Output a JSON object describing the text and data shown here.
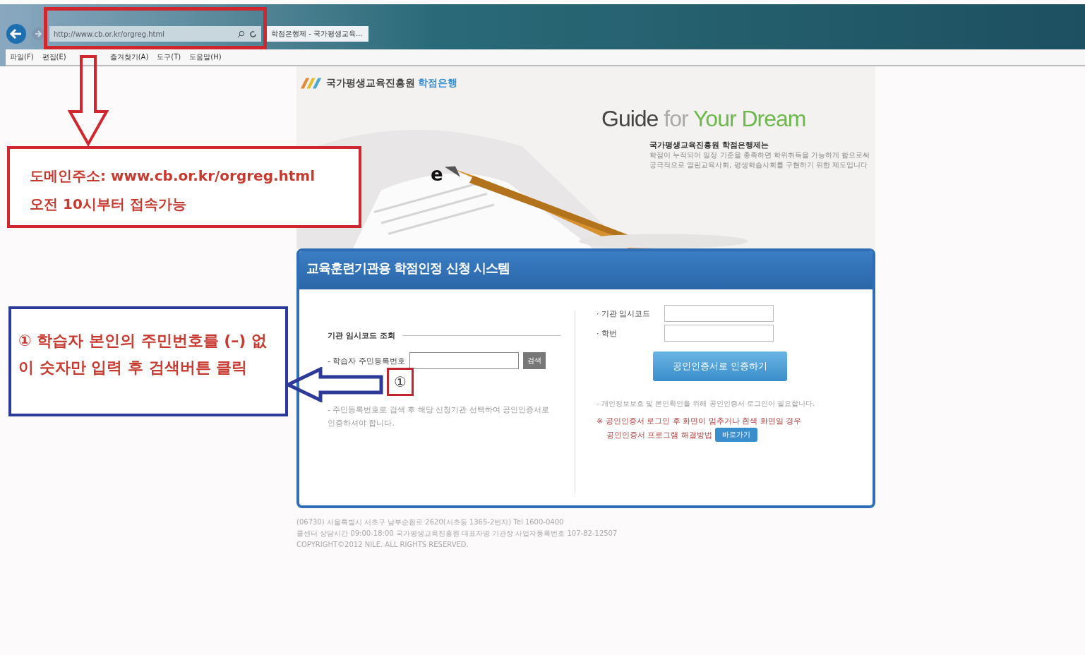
{
  "browser": {
    "url": "http://www.cb.or.kr/orgreg.html",
    "tab_title": "학점은행제 - 국가평생교육...",
    "menu": [
      "파일(F)",
      "편집(E)",
      "즐겨찾기(A)",
      "도구(T)",
      "도움말(H)"
    ]
  },
  "header": {
    "logo_text": "국가평생교육진흥원",
    "logo_accent": "학점은행",
    "slogan_1": "Guide",
    "slogan_2": "for",
    "slogan_3": "Your Dream",
    "intro_title": "국가평생교육진흥원 학점은행제는",
    "intro_lines": [
      "학점이 누적되어 일정 기준을 충족하면 학위취득을 가능하게 함으로써",
      "궁극적으로 열린교육사회, 평생학습사회를 구현하기 위한 제도입니다"
    ],
    "stray_letter": "e"
  },
  "panel": {
    "title": "교육훈련기관용 학점인정 신청 시스템",
    "left": {
      "section": "기관 임시코드 조회",
      "field_label": "- 학습자 주민등록번호",
      "search_button": "검색",
      "note": "- 주민등록번호로 검색 후 해당 신청기관 선택하여 공인인증서로 인증하셔야 합니다."
    },
    "right": {
      "fields": [
        {
          "label": "· 기관 임시코드"
        },
        {
          "label": "· 학번"
        }
      ],
      "login_button": "공인인증서로 인증하기",
      "note": "- 개인정보보호 및 본인확인을 위해 공인인증서 로그인이 필요합니다.",
      "warning_1": "※ 공인인증서 로그인 후 화면이 멈추거나 흰색 화면일 경우",
      "warning_2": "공인인증서 프로그램 해결방법",
      "go_button": "바로가기"
    }
  },
  "footer": [
    "(06730) 서울특별시 서초구 남부순환로 2620(서초동 1365-2번지) Tel 1600-0400",
    "콜센터 상담시간 09:00-18:00 국가평생교육진흥원 대표자명 기관장 사업자등록번호 107-82-12507",
    "COPYRIGHT©2012 NILE. ALL RIGHTS RESERVED."
  ],
  "annotations": {
    "domain_note": [
      "도메인주소: www.cb.or.kr/orgreg.html",
      "오전 10시부터 접속가능"
    ],
    "step_note": "① 학습자 본인의 주민번호를 (–) 없이 숫자만 입력 후 검색버튼 클릭",
    "step_marker": "①"
  }
}
